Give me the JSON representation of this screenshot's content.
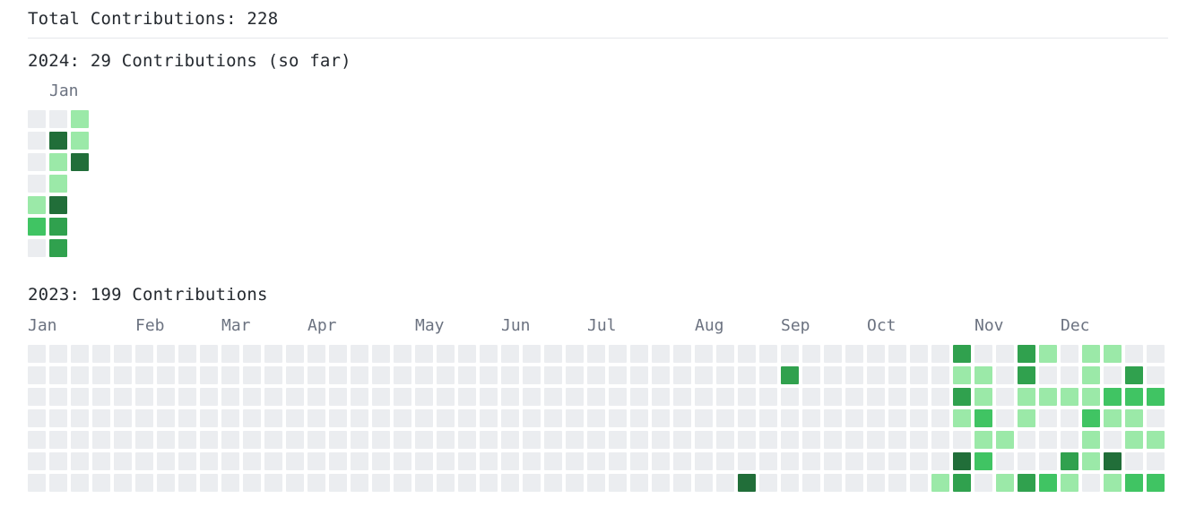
{
  "summary": {
    "total": "Total Contributions: 228"
  },
  "colors": {
    "level0": "#ebedf0",
    "level1": "#9be9a8",
    "level2": "#40c463",
    "level3": "#30a14e",
    "level4": "#216e39"
  },
  "years": [
    {
      "title": "2024: 29 Contributions (so far)",
      "months": [
        "Jan"
      ],
      "week_levels": [
        [
          0,
          0,
          0,
          0,
          1,
          2,
          0
        ],
        [
          0,
          4,
          1,
          1,
          4,
          3,
          3
        ],
        [
          1,
          1,
          4
        ]
      ]
    },
    {
      "title": "2023: 199 Contributions",
      "months": [
        "Jan",
        "Feb",
        "Mar",
        "Apr",
        "May",
        "Jun",
        "Jul",
        "Aug",
        "Sep",
        "Oct",
        "Nov",
        "Dec"
      ],
      "week_levels": [
        [
          0,
          0,
          0,
          0,
          0,
          0,
          0
        ],
        [
          0,
          0,
          0,
          0,
          0,
          0,
          0
        ],
        [
          0,
          0,
          0,
          0,
          0,
          0,
          0
        ],
        [
          0,
          0,
          0,
          0,
          0,
          0,
          0
        ],
        [
          0,
          0,
          0,
          0,
          0,
          0,
          0
        ],
        [
          0,
          0,
          0,
          0,
          0,
          0,
          0
        ],
        [
          0,
          0,
          0,
          0,
          0,
          0,
          0
        ],
        [
          0,
          0,
          0,
          0,
          0,
          0,
          0
        ],
        [
          0,
          0,
          0,
          0,
          0,
          0,
          0
        ],
        [
          0,
          0,
          0,
          0,
          0,
          0,
          0
        ],
        [
          0,
          0,
          0,
          0,
          0,
          0,
          0
        ],
        [
          0,
          0,
          0,
          0,
          0,
          0,
          0
        ],
        [
          0,
          0,
          0,
          0,
          0,
          0,
          0
        ],
        [
          0,
          0,
          0,
          0,
          0,
          0,
          0
        ],
        [
          0,
          0,
          0,
          0,
          0,
          0,
          0
        ],
        [
          0,
          0,
          0,
          0,
          0,
          0,
          0
        ],
        [
          0,
          0,
          0,
          0,
          0,
          0,
          0
        ],
        [
          0,
          0,
          0,
          0,
          0,
          0,
          0
        ],
        [
          0,
          0,
          0,
          0,
          0,
          0,
          0
        ],
        [
          0,
          0,
          0,
          0,
          0,
          0,
          0
        ],
        [
          0,
          0,
          0,
          0,
          0,
          0,
          0
        ],
        [
          0,
          0,
          0,
          0,
          0,
          0,
          0
        ],
        [
          0,
          0,
          0,
          0,
          0,
          0,
          0
        ],
        [
          0,
          0,
          0,
          0,
          0,
          0,
          0
        ],
        [
          0,
          0,
          0,
          0,
          0,
          0,
          0
        ],
        [
          0,
          0,
          0,
          0,
          0,
          0,
          0
        ],
        [
          0,
          0,
          0,
          0,
          0,
          0,
          0
        ],
        [
          0,
          0,
          0,
          0,
          0,
          0,
          0
        ],
        [
          0,
          0,
          0,
          0,
          0,
          0,
          0
        ],
        [
          0,
          0,
          0,
          0,
          0,
          0,
          0
        ],
        [
          0,
          0,
          0,
          0,
          0,
          0,
          0
        ],
        [
          0,
          0,
          0,
          0,
          0,
          0,
          0
        ],
        [
          0,
          0,
          0,
          0,
          0,
          0,
          0
        ],
        [
          0,
          0,
          0,
          0,
          0,
          0,
          4
        ],
        [
          0,
          0,
          0,
          0,
          0,
          0,
          0
        ],
        [
          0,
          3,
          0,
          0,
          0,
          0,
          0
        ],
        [
          0,
          0,
          0,
          0,
          0,
          0,
          0
        ],
        [
          0,
          0,
          0,
          0,
          0,
          0,
          0
        ],
        [
          0,
          0,
          0,
          0,
          0,
          0,
          0
        ],
        [
          0,
          0,
          0,
          0,
          0,
          0,
          0
        ],
        [
          0,
          0,
          0,
          0,
          0,
          0,
          0
        ],
        [
          0,
          0,
          0,
          0,
          0,
          0,
          0
        ],
        [
          0,
          0,
          0,
          0,
          0,
          0,
          1
        ],
        [
          3,
          1,
          3,
          1,
          0,
          4,
          3
        ],
        [
          0,
          1,
          1,
          2,
          1,
          2,
          0
        ],
        [
          0,
          0,
          0,
          0,
          1,
          0,
          1
        ],
        [
          3,
          3,
          1,
          1,
          0,
          0,
          3
        ],
        [
          1,
          0,
          1,
          0,
          0,
          0,
          2
        ],
        [
          0,
          0,
          1,
          0,
          0,
          3,
          1
        ],
        [
          1,
          1,
          1,
          2,
          1,
          1,
          0
        ],
        [
          1,
          0,
          2,
          1,
          0,
          4,
          1
        ],
        [
          0,
          3,
          2,
          1,
          1,
          0,
          2
        ],
        [
          0,
          0,
          2,
          0,
          1,
          0,
          2
        ]
      ]
    }
  ]
}
